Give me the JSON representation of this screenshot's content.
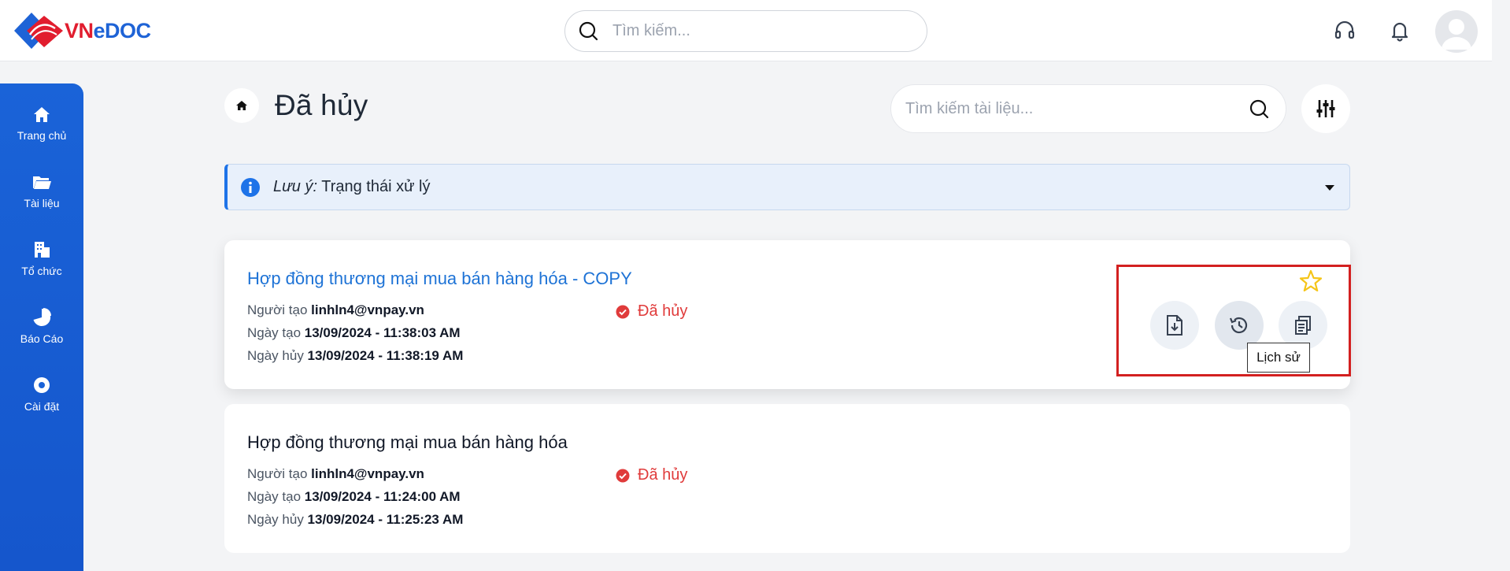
{
  "app": {
    "logo_text_vn": "VN",
    "logo_text_edoc": "eDOC"
  },
  "topbar": {
    "search_placeholder": "Tìm kiếm..."
  },
  "sidebar": {
    "items": [
      {
        "label": "Trang chủ",
        "icon": "home-icon"
      },
      {
        "label": "Tài liệu",
        "icon": "folder-icon"
      },
      {
        "label": "Tổ chức",
        "icon": "building-icon"
      },
      {
        "label": "Báo Cáo",
        "icon": "pie-chart-icon"
      },
      {
        "label": "Cài đặt",
        "icon": "gear-icon"
      }
    ]
  },
  "page": {
    "title": "Đã hủy",
    "search_placeholder": "Tìm kiếm tài liệu..."
  },
  "notice": {
    "prefix": "Lưu ý:",
    "text": " Trạng thái xử lý"
  },
  "documents": [
    {
      "title": "Hợp đồng thương mại mua bán hàng hóa - COPY",
      "creator_label": "Người tạo ",
      "creator": "linhln4@vnpay.vn",
      "created_label": "Ngày tạo ",
      "created": "13/09/2024 - 11:38:03 AM",
      "cancelled_label": "Ngày hủy ",
      "cancelled": "13/09/2024 - 11:38:19 AM",
      "status": "Đã hủy"
    },
    {
      "title": "Hợp đồng thương mại mua bán hàng hóa",
      "creator_label": "Người tạo ",
      "creator": "linhln4@vnpay.vn",
      "created_label": "Ngày tạo ",
      "created": "13/09/2024 - 11:24:00 AM",
      "cancelled_label": "Ngày hủy ",
      "cancelled": "13/09/2024 - 11:25:23 AM",
      "status": "Đã hủy"
    }
  ],
  "actions": {
    "tooltip": "Lịch sử"
  },
  "colors": {
    "primary": "#1e73d6",
    "sidebar": "#1a63d8",
    "status_cancelled": "#e03b3b",
    "star": "#f5c518",
    "highlight": "#d32020"
  }
}
